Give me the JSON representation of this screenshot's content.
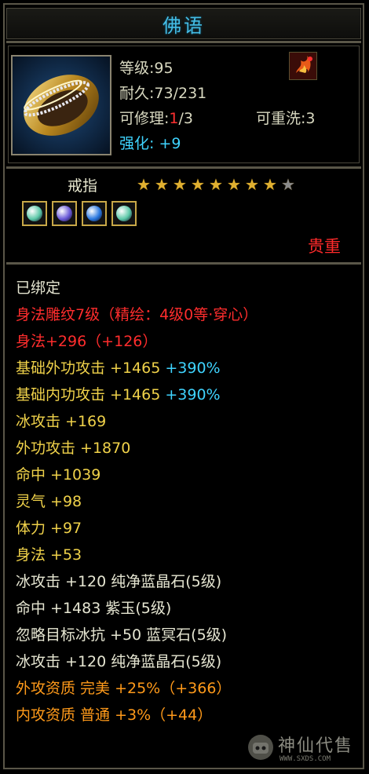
{
  "header": {
    "title": "佛语"
  },
  "item": {
    "level_label": "等级:",
    "level": "95",
    "durability_label": "耐久:",
    "durability": "73/231",
    "repair_label": "可修理:",
    "repair_current": "1",
    "repair_rest": "/3",
    "rewash_label": "可重洗:",
    "rewash": "3",
    "enhance_label": "强化:",
    "enhance": "+9",
    "type": "戒指",
    "stars_total": 9,
    "stars_filled": 8,
    "precious": "贵重",
    "gems": [
      {
        "name": "gem-1",
        "color": "#5cc8a8"
      },
      {
        "name": "gem-2",
        "color": "#6a5ad8"
      },
      {
        "name": "gem-3",
        "color": "#2a78e0"
      },
      {
        "name": "gem-4",
        "color": "#5cc8a8"
      }
    ]
  },
  "attributes": [
    {
      "parts": [
        {
          "t": "已绑定",
          "c": "white"
        }
      ]
    },
    {
      "parts": [
        {
          "t": "身法雕纹7级（精绘：4级0等·穿心）",
          "c": "red"
        }
      ]
    },
    {
      "parts": [
        {
          "t": "身法+296（+126）",
          "c": "red"
        }
      ]
    },
    {
      "parts": [
        {
          "t": "基础外功攻击 +1465 ",
          "c": "gold"
        },
        {
          "t": "+390%",
          "c": "cyan"
        }
      ]
    },
    {
      "parts": [
        {
          "t": "基础内功攻击 +1465 ",
          "c": "gold"
        },
        {
          "t": "+390%",
          "c": "cyan"
        }
      ]
    },
    {
      "parts": [
        {
          "t": "冰攻击 +169",
          "c": "gold"
        }
      ]
    },
    {
      "parts": [
        {
          "t": "外功攻击 +1870",
          "c": "gold"
        }
      ]
    },
    {
      "parts": [
        {
          "t": "命中 +1039",
          "c": "gold"
        }
      ]
    },
    {
      "parts": [
        {
          "t": "灵气 +98",
          "c": "gold"
        }
      ]
    },
    {
      "parts": [
        {
          "t": "体力 +97",
          "c": "gold"
        }
      ]
    },
    {
      "parts": [
        {
          "t": "身法 +53",
          "c": "gold"
        }
      ]
    },
    {
      "parts": [
        {
          "t": "冰攻击 +120 纯净蓝晶石(5级)",
          "c": "white"
        }
      ]
    },
    {
      "parts": [
        {
          "t": "命中 +1483 紫玉(5级)",
          "c": "white"
        }
      ]
    },
    {
      "parts": [
        {
          "t": "忽略目标冰抗 +50 蓝冥石(5级)",
          "c": "white"
        }
      ]
    },
    {
      "parts": [
        {
          "t": "冰攻击 +120 纯净蓝晶石(5级)",
          "c": "white"
        }
      ]
    },
    {
      "parts": [
        {
          "t": "外攻资质  完美 +25%（+366）",
          "c": "orange"
        }
      ]
    },
    {
      "parts": [
        {
          "t": "内攻资质  普通 +3%（+44）",
          "c": "orange"
        }
      ]
    }
  ],
  "watermark": {
    "text": "神仙代售",
    "url": "WWW.SXDS.COM"
  }
}
